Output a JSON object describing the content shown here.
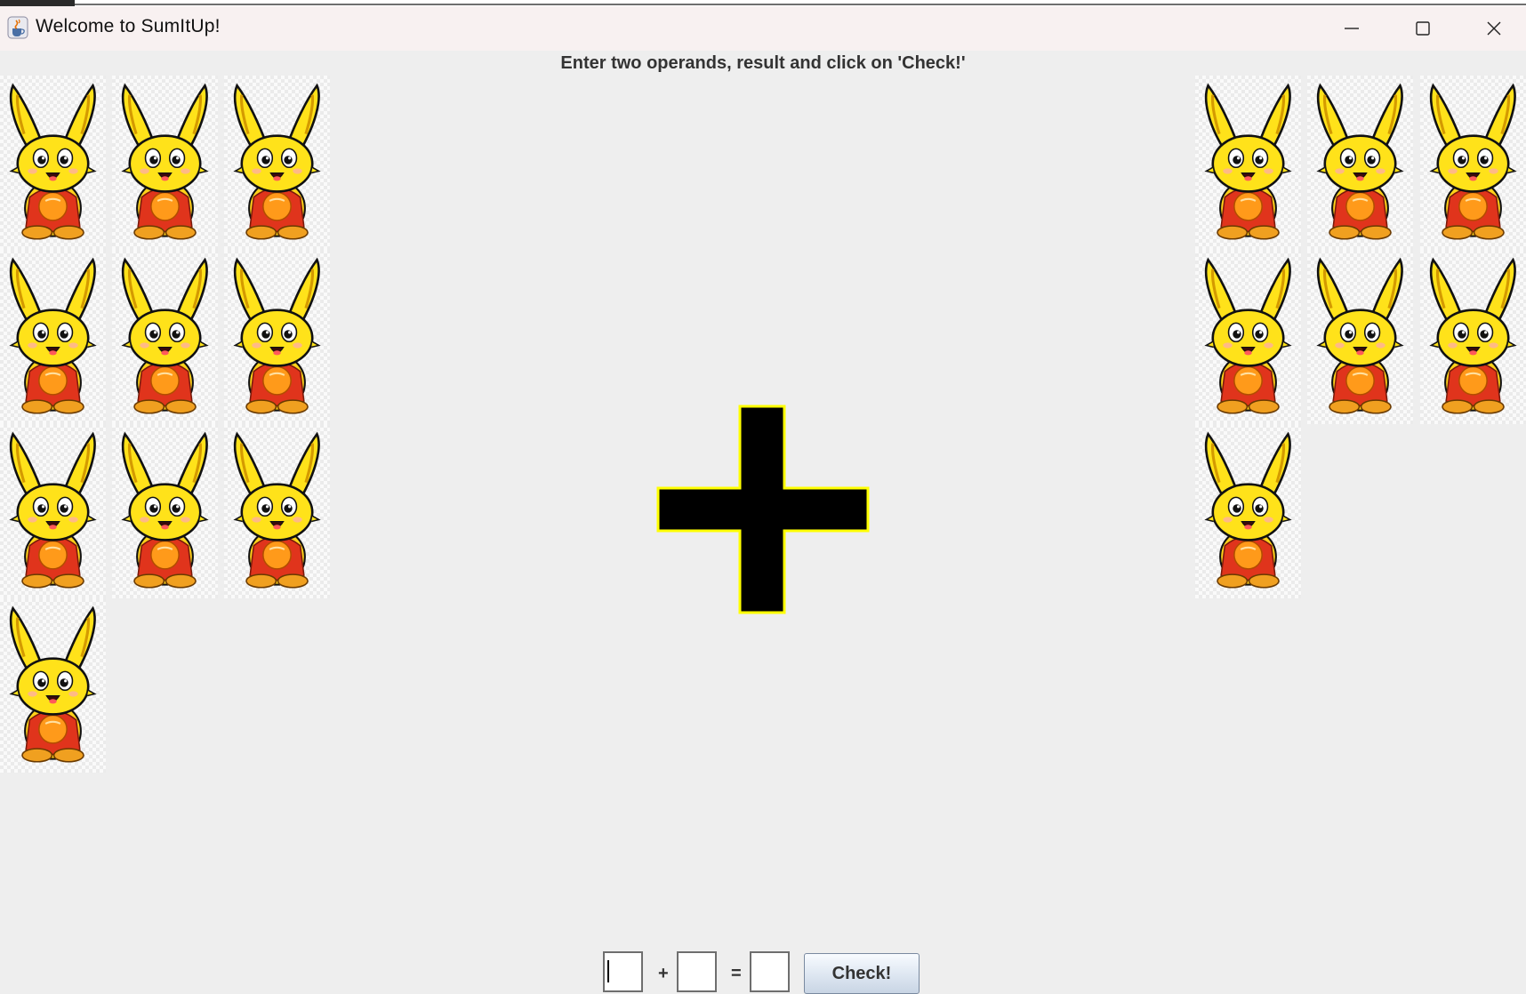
{
  "window": {
    "title": "Welcome to SumItUp!",
    "app_icon": "java-coffee-cup-icon",
    "controls": [
      "minimize-icon",
      "maximize-icon",
      "close-icon"
    ]
  },
  "instruction": "Enter two operands, result and click on 'Check!'",
  "left_operand_visual": {
    "count": 10,
    "icon": "bunny-image"
  },
  "operator_visual": {
    "symbol": "plus",
    "fill": "#000000",
    "outline": "#ffff00"
  },
  "right_operand_visual": {
    "count": 7,
    "icon": "bunny-image"
  },
  "form": {
    "operand1": "",
    "operator": "+",
    "operand2": "",
    "equals": "=",
    "result": "",
    "check_label": "Check!"
  }
}
